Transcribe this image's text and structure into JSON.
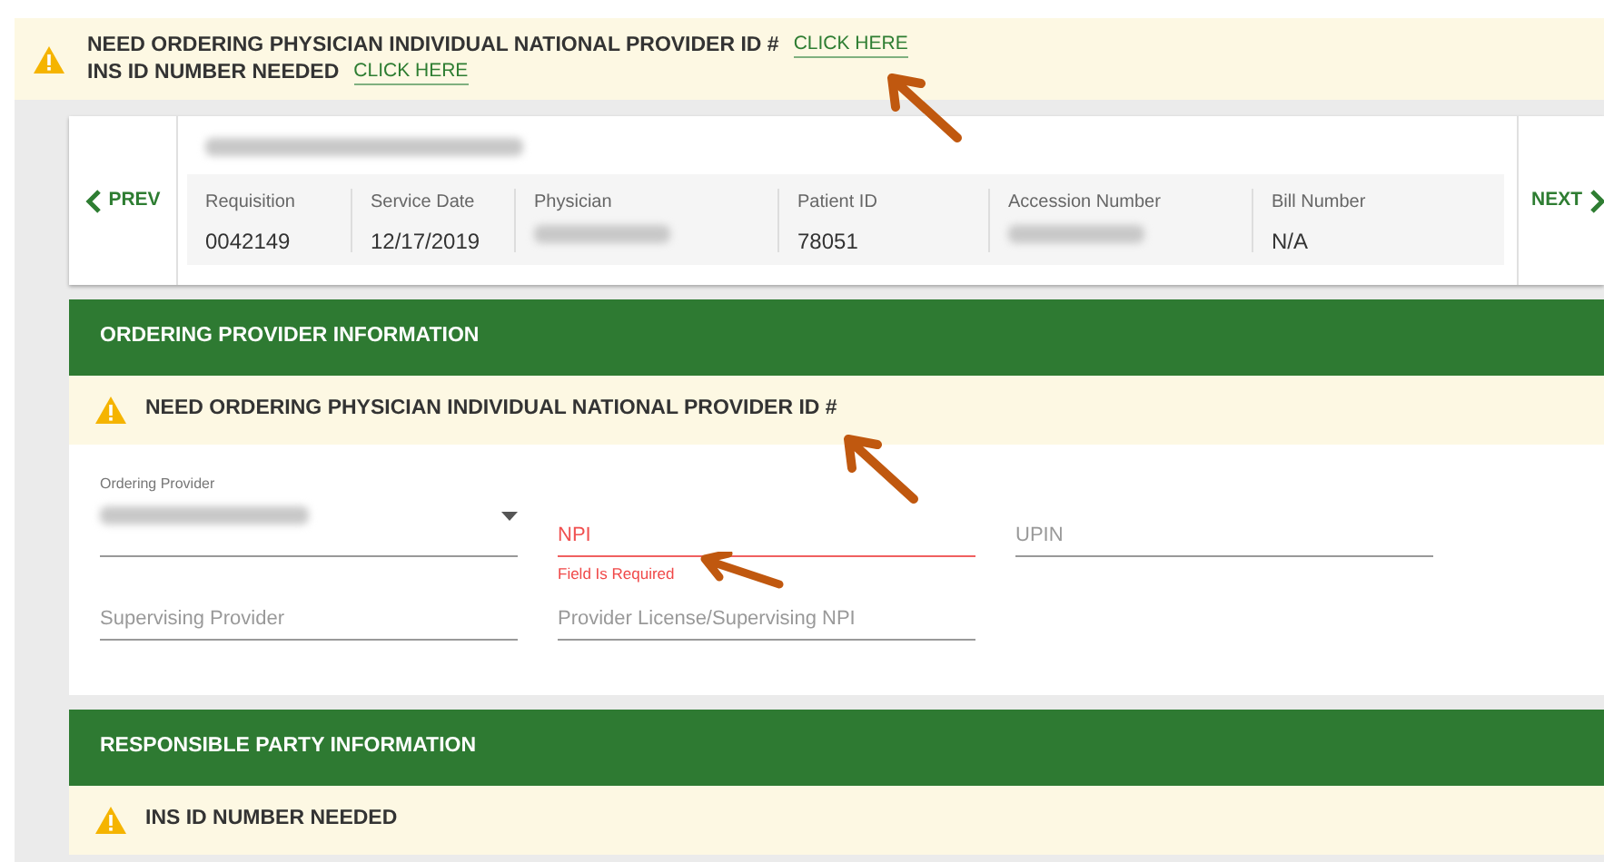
{
  "alert_banner": {
    "lines": [
      {
        "text": "NEED ORDERING PHYSICIAN INDIVIDUAL NATIONAL PROVIDER ID #",
        "link": "CLICK HERE"
      },
      {
        "text": "INS ID NUMBER NEEDED",
        "link": "CLICK HERE"
      }
    ]
  },
  "record_header": {
    "prev": "PREV",
    "next": "NEXT",
    "fields": [
      {
        "label": "Requisition",
        "value": "0042149"
      },
      {
        "label": "Service Date",
        "value": "12/17/2019"
      },
      {
        "label": "Physician",
        "redacted": true
      },
      {
        "label": "Patient ID",
        "value": "78051"
      },
      {
        "label": "Accession Number",
        "redacted": true
      },
      {
        "label": "Bill Number",
        "value": "N/A"
      }
    ]
  },
  "sections": [
    {
      "title": "ORDERING PROVIDER INFORMATION",
      "warning": "NEED ORDERING PHYSICIAN INDIVIDUAL NATIONAL PROVIDER ID #",
      "fields": [
        {
          "kind": "select",
          "label": "Ordering Provider",
          "redacted": true
        },
        {
          "kind": "text",
          "placeholder": "NPI",
          "error": "Field Is Required"
        },
        {
          "kind": "text",
          "placeholder": "UPIN"
        },
        {
          "kind": "text",
          "placeholder": "Supervising Provider"
        },
        {
          "kind": "text",
          "placeholder": "Provider License/Supervising NPI"
        }
      ]
    },
    {
      "title": "RESPONSIBLE PARTY INFORMATION",
      "warning": "INS ID NUMBER NEEDED"
    }
  ]
}
